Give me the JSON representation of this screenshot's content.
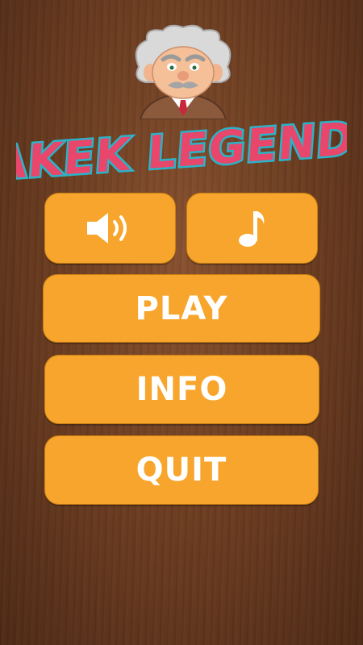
{
  "app": {
    "title": "YAKEK LEGENDS"
  },
  "colors": {
    "button": "#f7a52c",
    "button_text": "#ffffff",
    "background": "#6f3f22",
    "logo_fill": "#e8466a",
    "logo_outline": "#2bb3c7"
  },
  "menu": {
    "sound_icon": "speaker-icon",
    "music_icon": "music-note-icon",
    "play_label": "PLAY",
    "info_label": "INFO",
    "quit_label": "QUIT"
  }
}
